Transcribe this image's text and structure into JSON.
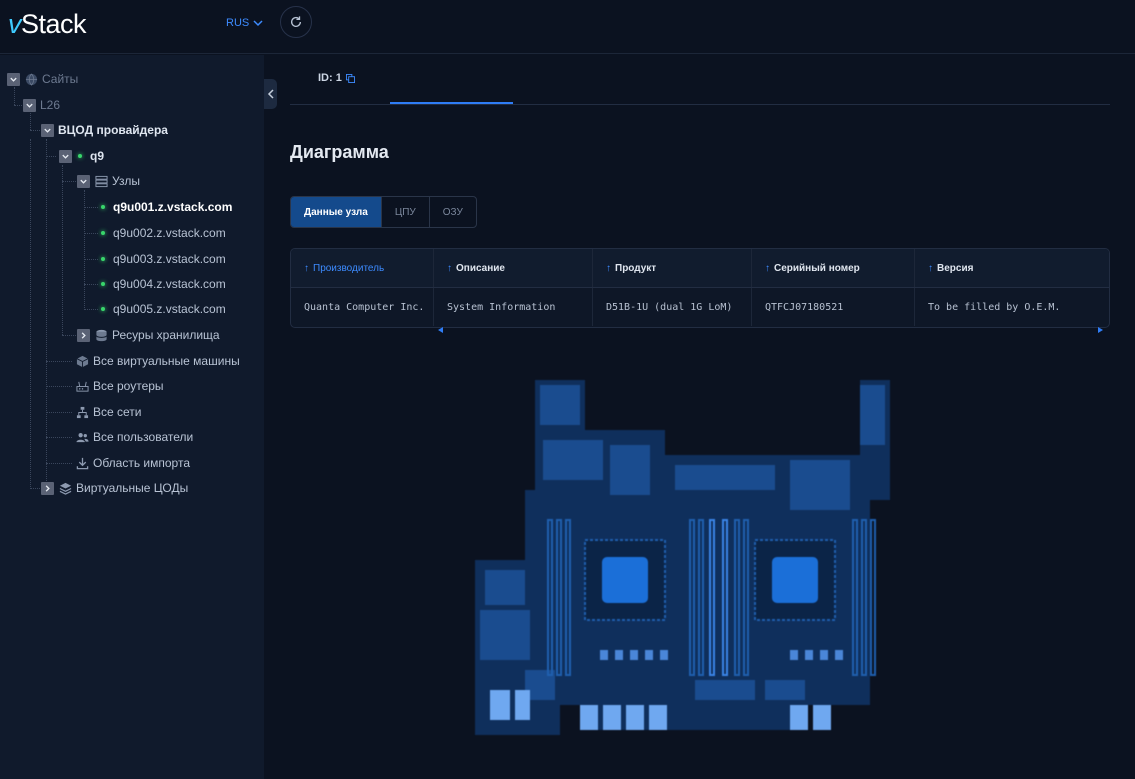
{
  "app": {
    "logo_v": "v",
    "logo_rest": "Stack",
    "language": "RUS"
  },
  "sidebar": {
    "sites": "Сайты",
    "l26": "L26",
    "provider_vdc": "ВЦОД провайдера",
    "cluster": "q9",
    "nodes": "Узлы",
    "node_items": [
      "q9u001.z.vstack.com",
      "q9u002.z.vstack.com",
      "q9u003.z.vstack.com",
      "q9u004.z.vstack.com",
      "q9u005.z.vstack.com"
    ],
    "storage": "Ресуры хранилища",
    "all_vms": "Все виртуальные машины",
    "all_routers": "Все роутеры",
    "all_networks": "Все сети",
    "all_users": "Все пользователи",
    "import_area": "Область импорта",
    "virtual_vdcs": "Виртуальные ЦОДы"
  },
  "main": {
    "id_tab": "ID: 1",
    "title": "Диаграмма",
    "segments": [
      "Данные узла",
      "ЦПУ",
      "ОЗУ"
    ],
    "table": {
      "headers": [
        "Производитель",
        "Описание",
        "Продукт",
        "Серийный номер",
        "Версия"
      ],
      "row": [
        "Quanta Computer Inc.",
        "System Information",
        "D51B-1U (dual 1G LoM)",
        "QTFCJ07180521",
        "To be filled by O.E.M."
      ]
    }
  },
  "colors": {
    "accent": "#2f7df6",
    "status_online": "#38d66b",
    "background": "#0b1220",
    "sidebar_bg": "#101a2c"
  },
  "icons": {
    "sites": "globe-icon",
    "nodes": "server-icon",
    "storage": "database-icon",
    "vms": "cube-icon",
    "routers": "router-icon",
    "networks": "network-icon",
    "users": "users-icon",
    "import": "download-icon",
    "virtual_vdcs": "layers-icon"
  }
}
